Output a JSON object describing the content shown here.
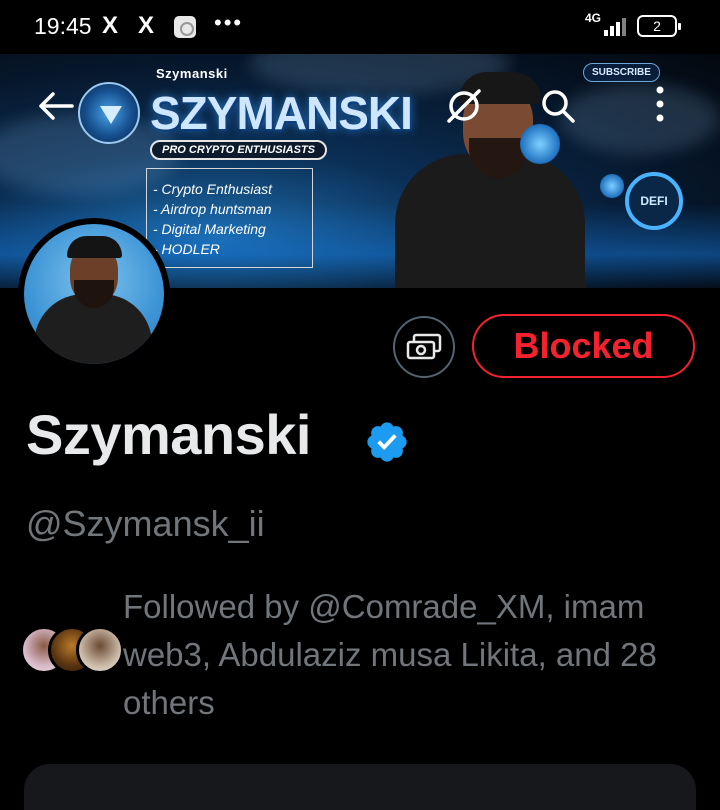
{
  "status_bar": {
    "time": "19:45",
    "app_icon_1": "X",
    "app_icon_2": "X",
    "more": "•••",
    "network": "4G",
    "battery": "2"
  },
  "banner": {
    "small_title": "Szymanski",
    "title": "SZYMANSKI",
    "tagline": "PRO CRYPTO ENTHUSIASTS",
    "list": [
      "- Crypto Enthusiast",
      "- Airdrop huntsman",
      "- Digital Marketing",
      "- HODLER"
    ],
    "subscribe": "SUBSCRIBE",
    "badge": "DEFI"
  },
  "toolbar": {
    "back_icon": "arrow-left-icon",
    "grok_icon": "grok-icon",
    "search_icon": "search-icon",
    "more_icon": "more-vertical-icon"
  },
  "profile": {
    "display_name": "Szymanski",
    "verified_color": "#1d9bf0",
    "handle": "@Szymansk_ii",
    "blocked_label": "Blocked",
    "blocked_color": "#f4212e",
    "followed_by": "Followed by @Comrade_XM, imam web3, Abdulaziz musa Likita, and 28 others"
  }
}
